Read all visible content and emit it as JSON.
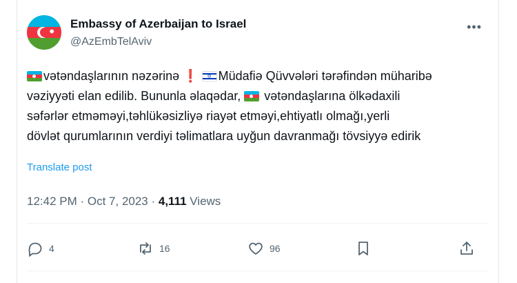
{
  "account": {
    "name": "Embassy of Azerbaijan to Israel",
    "handle": "@AzEmbTelAviv"
  },
  "more_icon": "more-horizontal-icon",
  "tweet": {
    "line1": {
      "az_flag": "flag-azerbaijan",
      "part1": "vətəndaşlarının nəzərinə",
      "excl": "❗",
      "il_flag": "flag-israel",
      "part2": "Müdafiə Qüvvələri tərəfindən müharibə"
    },
    "line2": {
      "part1": "vəziyyəti elan edilib. Bununla əlaqədar, ",
      "az_flag": "flag-azerbaijan",
      "part2": " vətəndaşlarına ölkədaxili"
    },
    "line3": "səfərlər etməməyi,təhlükəsizliyə riayət etməyi,ehtiyatlı olmağı,yerli",
    "line4": "dövlət qurumlarının verdiyi təlimatlara uyğun davranmağı tövsiyyə edirik"
  },
  "translate_label": "Translate post",
  "meta": {
    "time": "12:42 PM",
    "sep": " · ",
    "date": "Oct 7, 2023",
    "sep2": " · ",
    "views_count": "4,111",
    "views_label": " Views"
  },
  "actions": {
    "reply": {
      "icon": "reply-icon",
      "count": "4"
    },
    "repost": {
      "icon": "repost-icon",
      "count": "16"
    },
    "like": {
      "icon": "heart-icon",
      "count": "96"
    },
    "bookmark": {
      "icon": "bookmark-icon"
    },
    "share": {
      "icon": "share-icon"
    }
  },
  "colors": {
    "link_blue": "#1d9bf0",
    "text_muted": "#536471",
    "az_blue": "#00b5e2",
    "az_red": "#ef3340",
    "az_green": "#509e2f",
    "il_blue": "#0038b8"
  }
}
